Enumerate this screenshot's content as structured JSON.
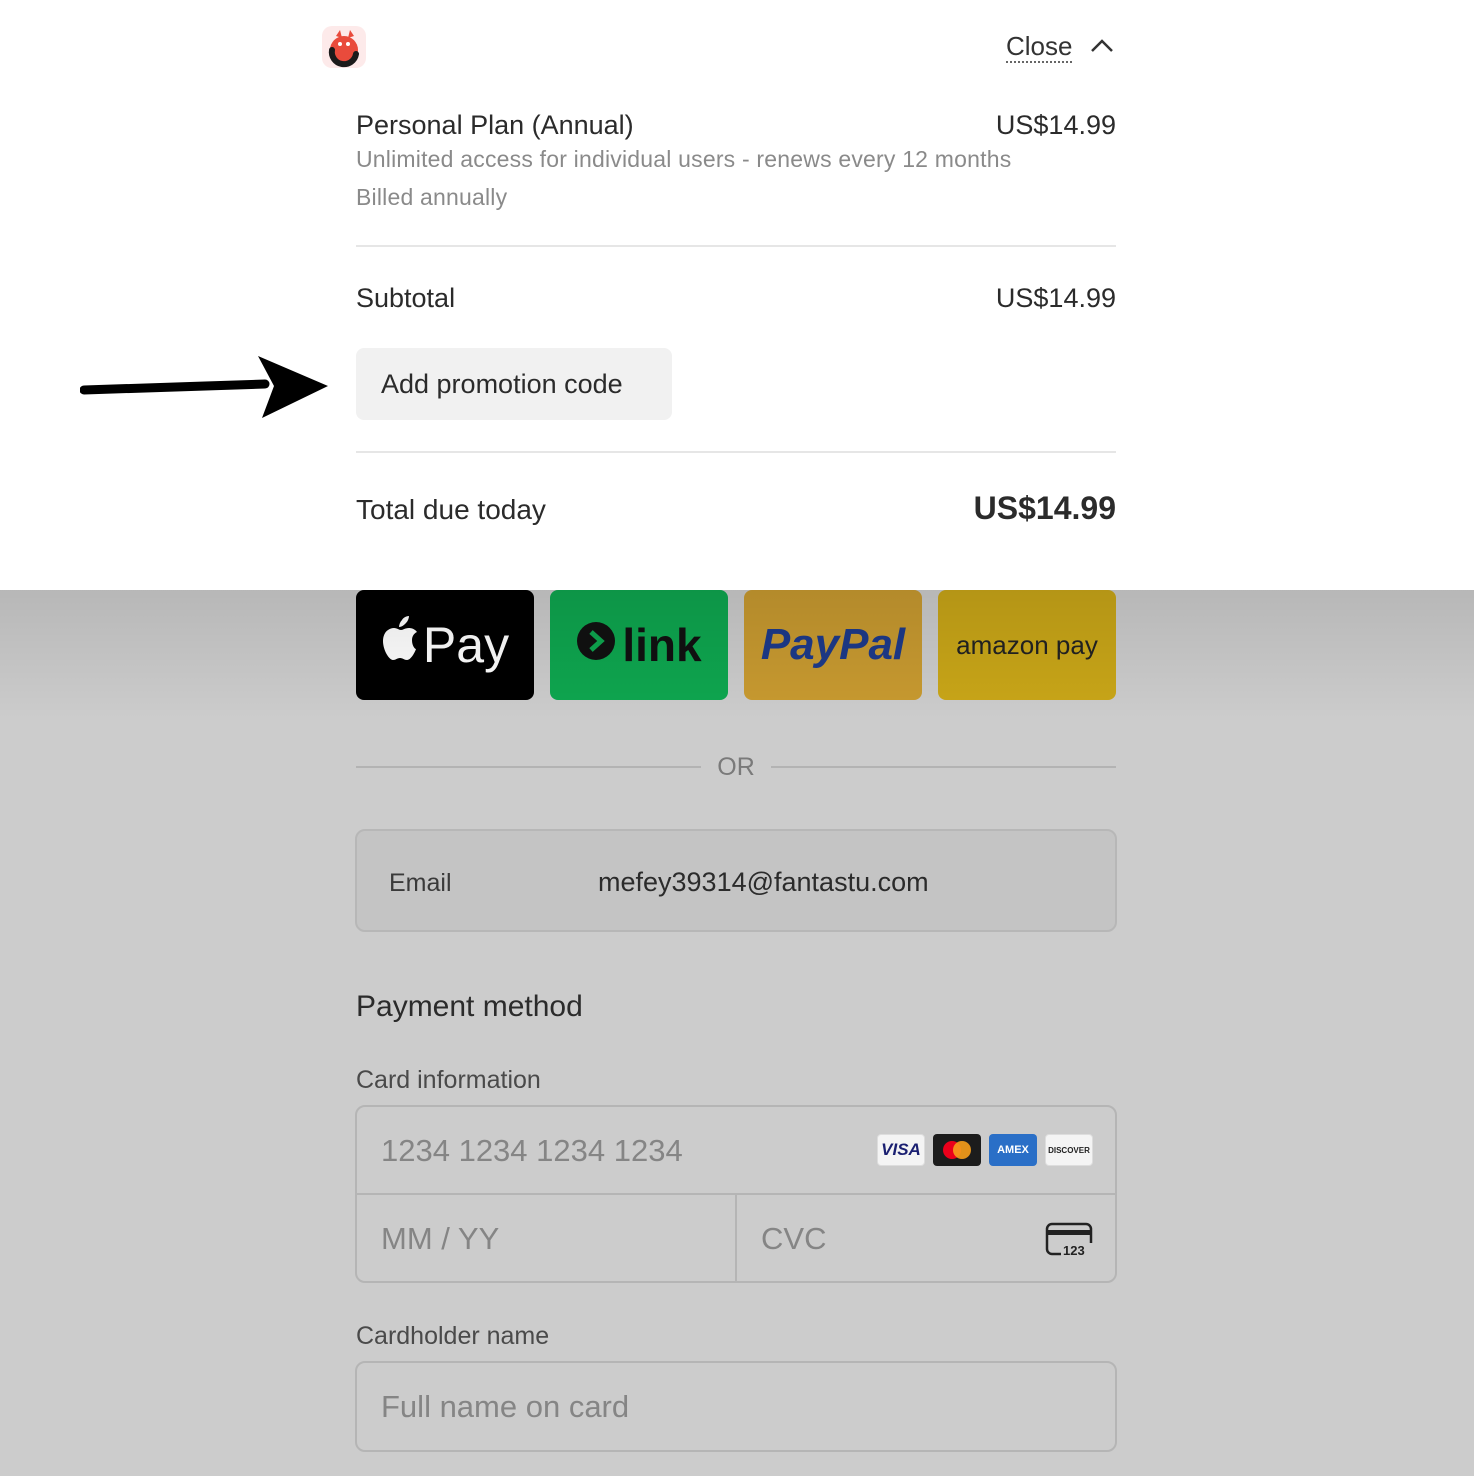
{
  "header": {
    "logo_icon": "merchant-logo-icon",
    "close_label": "Close",
    "close_icon": "chevron-up-icon"
  },
  "order": {
    "plan_name": "Personal Plan (Annual)",
    "plan_price": "US$14.99",
    "plan_description": "Unlimited access for individual users - renews every 12 months",
    "billing_note": "Billed annually",
    "subtotal_label": "Subtotal",
    "subtotal_value": "US$14.99",
    "promo_label": "Add promotion code",
    "total_label": "Total due today",
    "total_value": "US$14.99"
  },
  "annotation": {
    "arrow_icon": "pointer-arrow-icon"
  },
  "express_checkout": {
    "apple_pay": "Pay",
    "link": "link",
    "paypal": "PayPal",
    "amazon_pay": "amazon pay",
    "or_label": "OR"
  },
  "contact": {
    "email_label": "Email",
    "email_value": "mefey39314@fantastu.com"
  },
  "payment": {
    "section_title": "Payment method",
    "card_label": "Card information",
    "card_number_placeholder": "1234 1234 1234 1234",
    "expiry_placeholder": "MM / YY",
    "cvc_placeholder": "CVC",
    "cvc_icon_text": "123",
    "card_brands": [
      "VISA",
      "mastercard",
      "AMEX",
      "DISCOVER"
    ],
    "cardholder_label": "Cardholder name",
    "cardholder_placeholder": "Full name on card"
  },
  "colors": {
    "apple_pay_bg": "#000000",
    "link_bg": "#0ea64f",
    "paypal_bg": "#c89a30",
    "amazon_bg": "#c9a618",
    "overlay_bg": "#cccccc"
  }
}
